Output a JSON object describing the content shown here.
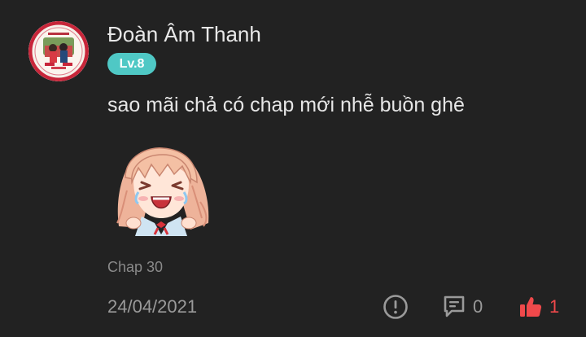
{
  "comment": {
    "author": {
      "name": "Đoàn Âm Thanh",
      "level": "Lv.8"
    },
    "text": "sao mãi chả có chap mới nhễ buồn ghê",
    "sticker": "crying-anime-girl-sticker",
    "chapter": "Chap 30",
    "date": "24/04/2021",
    "actions": {
      "report_icon": "exclamation-circle-icon",
      "reply_icon": "comment-bubble-icon",
      "reply_count": "0",
      "like_icon": "thumbs-up-icon",
      "like_count": "1"
    }
  },
  "colors": {
    "background": "#222222",
    "badge": "#4fc8c5",
    "like": "#f0494b",
    "muted_text": "#9a9a9a"
  }
}
